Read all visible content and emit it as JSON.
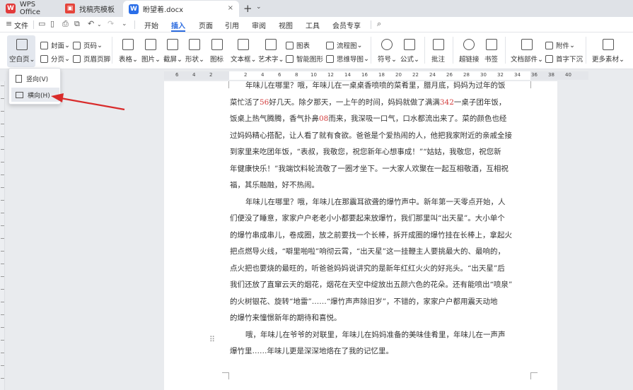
{
  "tabs": {
    "wps": "WPS Office",
    "template": "找稿壳模板",
    "doc": "盼望着.docx",
    "close": "×",
    "add": "+",
    "more": "⌄"
  },
  "menu": {
    "file": "文件",
    "items": [
      "开始",
      "插入",
      "页面",
      "引用",
      "审阅",
      "视图",
      "工具",
      "会员专享"
    ]
  },
  "ribbon": {
    "blank_page": "空白页",
    "cover": "封面",
    "page_break": "分页",
    "page_number": "页码",
    "header_footer": "页眉页脚",
    "table": "表格",
    "picture": "图片",
    "screenshot": "截屏",
    "shape": "形状",
    "icon": "图标",
    "textbox": "文本框",
    "wordart": "艺术字",
    "chart": "图表",
    "smart_graphic": "智能图形",
    "flowchart": "流程图",
    "mindmap": "思维导图",
    "symbol": "符号",
    "formula": "公式",
    "comment": "批注",
    "hyperlink": "超链接",
    "bookmark": "书签",
    "doc_parts": "文档部件",
    "attachment": "附件",
    "drop_cap": "首字下沉",
    "more_material": "更多素材"
  },
  "dropdown": {
    "portrait": "竖向(V)",
    "landscape": "横向(H)"
  },
  "ruler": {
    "numbers": [
      "6",
      "4",
      "2",
      "2",
      "4",
      "6",
      "8",
      "10",
      "12",
      "14",
      "16",
      "18",
      "20",
      "22",
      "24",
      "26",
      "28",
      "30",
      "32",
      "34",
      "36",
      "38",
      "40"
    ]
  },
  "document": {
    "l1": "年味儿在哪里？哦，年味儿在一桌桌香喷喷的菜肴里，腊月底，妈妈为过年的饭",
    "l2a": "菜忙活了",
    "l2n": "56",
    "l2b": "好几天。除夕那天，一上午的时间，妈妈就做了满满",
    "l2n2": "342",
    "l2c": "一桌子团年饭，",
    "l3a": "饭桌上热气腾腾，香气扑鼻",
    "l3n": "08",
    "l3b": "而来，我深吸一口气，口水都流出来了。菜的颜色也经",
    "l4": "过妈妈精心搭配，让人看了就有食欲。爸爸是个爱热闹的人，他把我家附近的亲戚全接",
    "l5": "到家里来吃团年饭，“表叔，我敬您，祝您新年心想事成！”“姑姑，我敬您，祝您新",
    "l6": "年健康快乐！”我端饮料轮流敬了一圈才坐下。一大家人欢聚在一起互相敬酒，互相祝",
    "l7": "福，其乐融融，好不热闹。",
    "l8": "年味儿在哪里？哦，年味儿在那震耳欲聋的爆竹声中。新年第一天零点开始，人",
    "l9": "们便没了睡意，家家户户老老小小都要起来放爆竹，我们那里叫“出天星”。大小单个",
    "l10": "的爆竹串成串儿，卷成圈，放之前要找一个长棒，拆开成圈的爆竹挂在长棒上，拿起火",
    "l11": "把点燃导火线，“噼里啪啦”响彻云霄，“出天星”这一挂鞭主人要挑最大的、最响的，",
    "l12": "点火把也要烧的最旺的，听爸爸妈妈说讲究的是新年红红火火的好兆头。“出天星”后",
    "l13": "我们还放了直窜云天的烟花，烟花在天空中绽放出五颜六色的花朵。还有能喷出“喷泉”",
    "l14": "的火树银花、旋转“地雷”……“爆竹声声除旧岁”，不错的，家家户户都用震天动地",
    "l15": "的爆竹来憧憬新年的期待和喜悦。",
    "l16": "哦，年味儿在爷爷的对联里，年味儿在妈妈准备的美味佳肴里，年味儿在一声声",
    "l17": "爆竹里……年味儿更是深深地烙在了我的记忆里。"
  },
  "colors": {
    "accent": "#2d6cdf",
    "number_red": "#d23c3c",
    "arrow": "#d92b2b"
  }
}
